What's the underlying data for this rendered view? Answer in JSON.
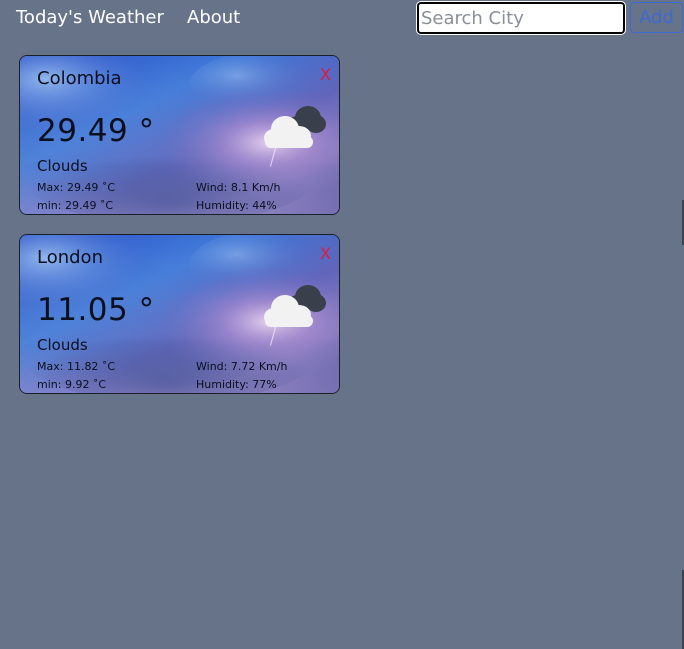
{
  "nav": {
    "brand": "Today's Weather",
    "about": "About"
  },
  "search": {
    "placeholder": "Search City",
    "value": "",
    "add_label": "Add"
  },
  "cards": [
    {
      "city": "Colombia",
      "close": "X",
      "temp": "29.49 °",
      "desc": "Clouds",
      "max": "Max: 29.49 ˚C",
      "min": "min: 29.49 ˚C",
      "wind": "Wind: 8.1 Km/h",
      "humidity": "Humidity: 44%",
      "icon": "cloudy-icon"
    },
    {
      "city": "London",
      "close": "X",
      "temp": "11.05 °",
      "desc": "Clouds",
      "max": "Max: 11.82 ˚C",
      "min": "min: 9.92 ˚C",
      "wind": "Wind: 7.72 Km/h",
      "humidity": "Humidity: 77%",
      "icon": "cloudy-icon"
    }
  ],
  "colors": {
    "page_background": "#667388",
    "close_red": "#e0193c",
    "add_blue": "#3e6ad1"
  }
}
